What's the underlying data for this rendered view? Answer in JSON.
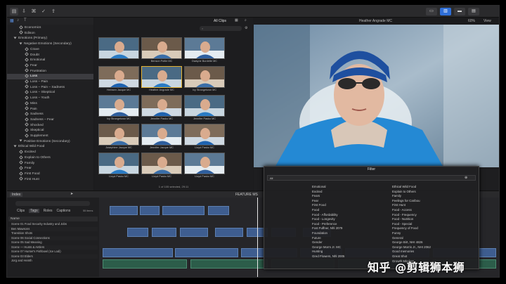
{
  "viewer_header": {
    "left": "Heather Angrade MC",
    "right_zoom": "60%",
    "right_view": "View"
  },
  "browser_header": {
    "label": "All Clips"
  },
  "library": {
    "items": [
      {
        "label": "Economics",
        "type": "kw",
        "indent": 2
      },
      {
        "label": "Edison",
        "type": "kw",
        "indent": 2
      },
      {
        "label": "Emotions (Primary)",
        "type": "grp",
        "indent": 1
      },
      {
        "label": "Negative Emotions (Secondary)",
        "type": "grp",
        "indent": 2
      },
      {
        "label": "Crave",
        "type": "kw",
        "indent": 3
      },
      {
        "label": "Doubt",
        "type": "kw",
        "indent": 3
      },
      {
        "label": "Emotional",
        "type": "kw",
        "indent": 3
      },
      {
        "label": "Fear",
        "type": "kw",
        "indent": 3
      },
      {
        "label": "Frustration",
        "type": "kw",
        "indent": 3
      },
      {
        "label": "Loss",
        "type": "kw",
        "indent": 3,
        "selected": true
      },
      {
        "label": "Loss – Pain",
        "type": "kw",
        "indent": 3
      },
      {
        "label": "Loss – Pain – Sadness",
        "type": "kw",
        "indent": 3
      },
      {
        "label": "Loss – Skeptical",
        "type": "kw",
        "indent": 3
      },
      {
        "label": "Loss – Youth",
        "type": "kw",
        "indent": 3
      },
      {
        "label": "Miss",
        "type": "kw",
        "indent": 3
      },
      {
        "label": "Pain",
        "type": "kw",
        "indent": 3
      },
      {
        "label": "Sadness",
        "type": "kw",
        "indent": 3
      },
      {
        "label": "Sadness – Fear",
        "type": "kw",
        "indent": 3
      },
      {
        "label": "Shocked",
        "type": "kw",
        "indent": 3
      },
      {
        "label": "Skeptical",
        "type": "kw",
        "indent": 3
      },
      {
        "label": "Supplement",
        "type": "kw",
        "indent": 3
      },
      {
        "label": "Positive Emotions (Secondary)",
        "type": "grp",
        "indent": 2
      },
      {
        "label": "Ethical Wild Food",
        "type": "grp",
        "indent": 1
      },
      {
        "label": "Excited",
        "type": "kw",
        "indent": 2
      },
      {
        "label": "Explain to Others",
        "type": "kw",
        "indent": 2
      },
      {
        "label": "Family",
        "type": "kw",
        "indent": 2
      },
      {
        "label": "Fear",
        "type": "kw",
        "indent": 2
      },
      {
        "label": "First Food",
        "type": "kw",
        "indent": 2
      },
      {
        "label": "First Hunt",
        "type": "kw",
        "indent": 2
      }
    ]
  },
  "clips": [
    {
      "caption": "",
      "row": 0,
      "col": 0
    },
    {
      "caption": "Benson Pottle MC",
      "row": 0,
      "col": 1
    },
    {
      "caption": "Dwayne Burdette MC",
      "row": 0,
      "col": 2
    },
    {
      "caption": "Heinsen Jacque MC",
      "row": 1,
      "col": 0
    },
    {
      "caption": "Heather Angrade MC",
      "row": 1,
      "col": 1,
      "selected": true
    },
    {
      "caption": "Ivy Strangetown MC",
      "row": 1,
      "col": 2
    },
    {
      "caption": "Ivy Strangetown MC",
      "row": 2,
      "col": 0
    },
    {
      "caption": "Jennifer Pasko MC",
      "row": 2,
      "col": 1
    },
    {
      "caption": "Jennifer Pasko MC",
      "row": 2,
      "col": 2
    },
    {
      "caption": "Josephine Jacque MC",
      "row": 3,
      "col": 0
    },
    {
      "caption": "Jennifer Jacque MC",
      "row": 3,
      "col": 1
    },
    {
      "caption": "Lloyd Pasko MC",
      "row": 3,
      "col": 2
    },
    {
      "caption": "Lloyd Pasko MC",
      "row": 4,
      "col": 0
    },
    {
      "caption": "Lloyd Pasko MC",
      "row": 4,
      "col": 1
    },
    {
      "caption": "Lloyd Pasko MC",
      "row": 4,
      "col": 2
    }
  ],
  "browser_footer": "1 of 105 selected, 29:11",
  "timeline_bar": {
    "index": "Index",
    "center": "FEATURE MS"
  },
  "index_panel": {
    "tabs": [
      "Clips",
      "Tags",
      "Roles",
      "Captions"
    ],
    "count": "55 items",
    "column": "Name",
    "rows": [
      "Scene 01 Food Security Industry and Jobs",
      "Ben Mawsons",
      "Transition Shots",
      "Scene 06 Social Connections",
      "Scene 05 Sad Meaning",
      "Scene — Hunts & Antlers",
      "Scene 07 Hunter's Fishbowl (Ice Lodi)",
      "Scene 03 Elders",
      "Jorg and Heinth"
    ]
  },
  "filter_hud": {
    "title": "Filter",
    "search_label": "All",
    "left_col": [
      "Emotional",
      "Excited",
      "Fears",
      "Fear",
      "First Food",
      "Food",
      "Food - Affordability",
      "Food - Longevity",
      "Food - Preference",
      "Fost Fuffner, Nhl 2079",
      "Foundation",
      "Future",
      "Gender",
      "George Morrs Jr. MC",
      "Hunting",
      "Gred Flowers, Nhl 2005"
    ],
    "right_col": [
      "Ethical Wild Food",
      "Explain to Others",
      "Family",
      "Feelings for Caribou",
      "First Hunt",
      "Food - Access",
      "Food - Frequency",
      "Food - Nutrition",
      "Food - Special",
      "Frequency of Food",
      "Funny",
      "General",
      "George Birt, NHI 4826",
      "George Morris Jr., NHI 2062",
      "Good memories",
      "Great Shot",
      "Growth Mindset"
    ]
  },
  "watermark": "知乎 @剪辑狮本狮"
}
